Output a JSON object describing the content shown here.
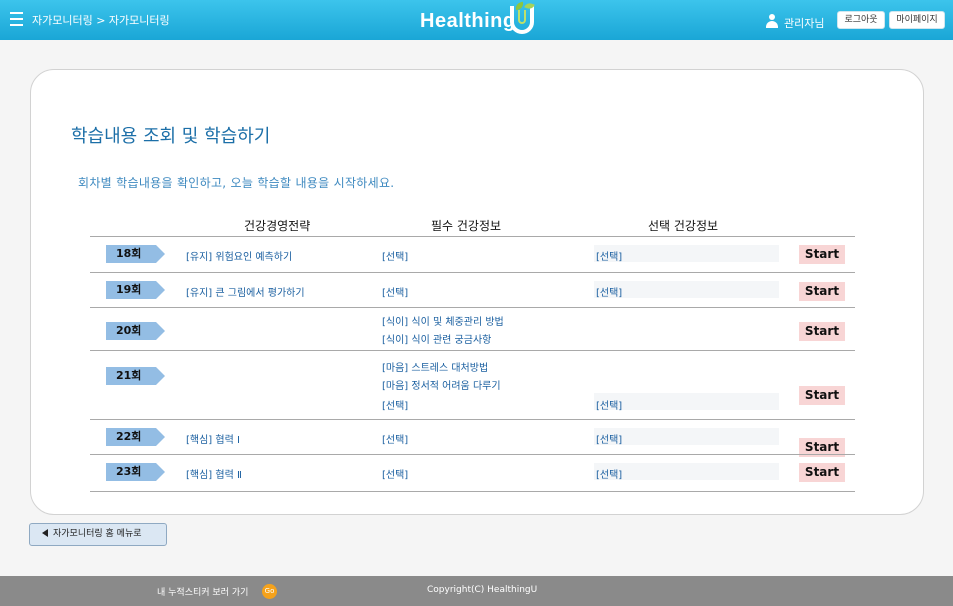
{
  "header": {
    "breadcrumb": "자가모니터링 > 자가모니터링",
    "logo_text": "Healthing",
    "user_name": "관리자님",
    "logout_label": "로그아웃",
    "mypage_label": "마이페이지"
  },
  "main": {
    "title": "학습내용 조회 및 학습하기",
    "subtitle": "회차별 학습내용을 확인하고, 오늘 학습할 내용을 시작하세요.",
    "columns": [
      "건강경영전략",
      "필수 건강정보",
      "선택 건강정보"
    ],
    "start_label": "Start",
    "rows": [
      {
        "round": "18회",
        "strategy": "[유지] 위험요인 예측하기",
        "required": [
          "[선택]"
        ],
        "optional": "[선택]"
      },
      {
        "round": "19회",
        "strategy": "[유지] 큰 그림에서 평가하기",
        "required": [
          "[선택]"
        ],
        "optional": "[선택]"
      },
      {
        "round": "20회",
        "strategy": "",
        "required": [
          "[식이] 식이 및 체중관리 방법",
          "[식이] 식이 관련 궁금사항"
        ],
        "optional": ""
      },
      {
        "round": "21회",
        "strategy": "",
        "required": [
          "[마음] 스트레스 대처방법",
          "[마음] 정서적 어려움 다루기",
          "[선택]"
        ],
        "optional": "[선택]"
      },
      {
        "round": "22회",
        "strategy": "[핵심] 협력 Ⅰ",
        "required": [
          "[선택]"
        ],
        "optional": "[선택]"
      },
      {
        "round": "23회",
        "strategy": "[핵심] 협력 Ⅱ",
        "required": [
          "[선택]"
        ],
        "optional": "[선택]"
      }
    ]
  },
  "bottom": {
    "home_label": "자가모니터링 홈 메뉴로"
  },
  "footer": {
    "link_label": "내 누적스티커 보러 가기",
    "coin_label": "Go",
    "copyright": "Copyright(C) HealthingU"
  },
  "colors": {
    "header": "#1aa6d6",
    "title": "#1c6fa8",
    "round_tag": "#93bde4",
    "start_button": "#f8d5d5",
    "footer": "#8a8a8a"
  }
}
